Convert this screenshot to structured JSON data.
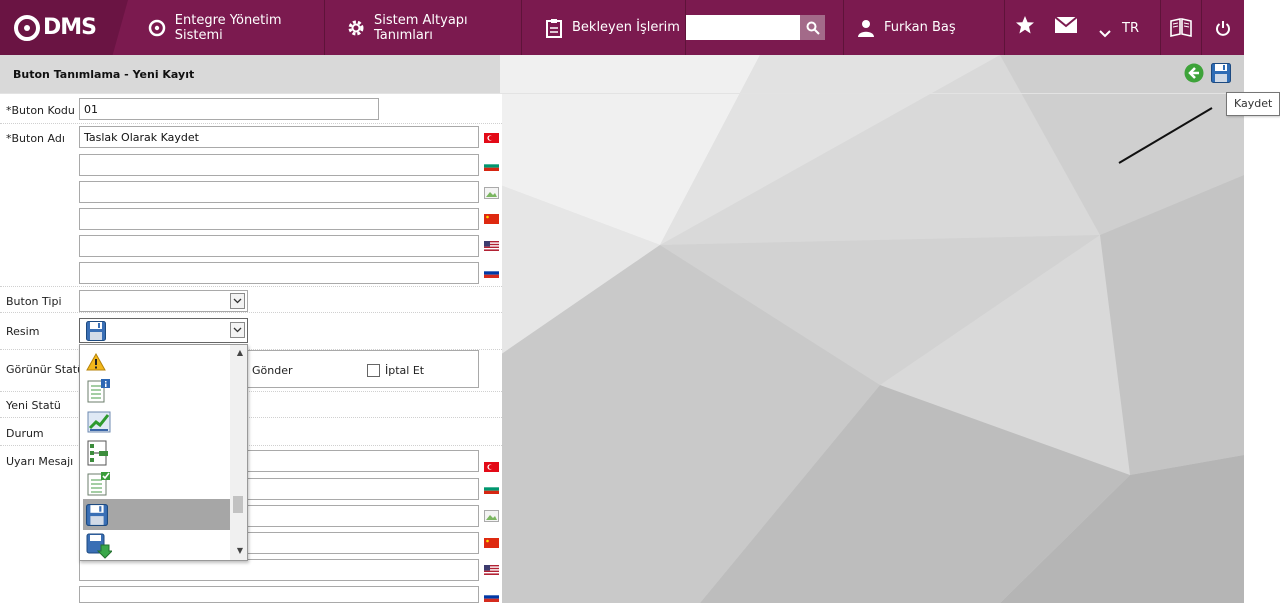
{
  "header": {
    "logo_text": "DMS",
    "nav": [
      {
        "label": "Entegre Yönetim Sistemi",
        "icon": "q-logo-icon"
      },
      {
        "label": "Sistem Altyapı Tanımları",
        "icon": "gear-icon"
      },
      {
        "label": "Bekleyen İşlerim",
        "icon": "clipboard-icon"
      }
    ],
    "search": {
      "value": "",
      "placeholder": ""
    },
    "user_name": "Furkan Baş",
    "language": "TR",
    "icons": [
      "star-icon",
      "mail-icon",
      "chevron-down-icon",
      "manual-book-icon",
      "power-icon"
    ],
    "brand_color": "#7b1a4f"
  },
  "panel": {
    "title": "Buton Tanımlama - Yeni Kayıt",
    "toolbar": {
      "back_icon": "back-arrow-icon",
      "save_icon": "save-icon"
    },
    "tooltip": "Kaydet"
  },
  "form": {
    "buton_kodu": {
      "label": "*Buton Kodu",
      "value": "01"
    },
    "buton_adi": {
      "label": "*Buton Adı",
      "translations": [
        {
          "lang_flag": "flag-tr-icon",
          "value": "Taslak Olarak Kaydet"
        },
        {
          "lang_flag": "flag-bg-icon",
          "value": ""
        },
        {
          "lang_flag": "flag-broken-icon",
          "value": ""
        },
        {
          "lang_flag": "flag-cn-icon",
          "value": ""
        },
        {
          "lang_flag": "flag-us-icon",
          "value": ""
        },
        {
          "lang_flag": "flag-ru-icon",
          "value": ""
        }
      ]
    },
    "buton_tipi": {
      "label": "Buton Tipi",
      "value": ""
    },
    "resim": {
      "label": "Resim",
      "selected_icon": "floppy-disk-icon",
      "options": [
        "warning-icon",
        "document-info-icon",
        "chart-up-icon",
        "workflow-icon",
        "document-check-icon",
        "floppy-disk-icon",
        "floppy-download-icon"
      ],
      "selected_index": 5
    },
    "gorunur_statu": {
      "label": "Görünür Statü",
      "options": [
        {
          "label": "Gönder",
          "checked": false
        },
        {
          "label": "İptal Et",
          "checked": false
        }
      ]
    },
    "yeni_statu": {
      "label": "Yeni Statü"
    },
    "durum": {
      "label": "Durum"
    },
    "uyari_mesaji": {
      "label": "Uyarı Mesajı"
    }
  }
}
